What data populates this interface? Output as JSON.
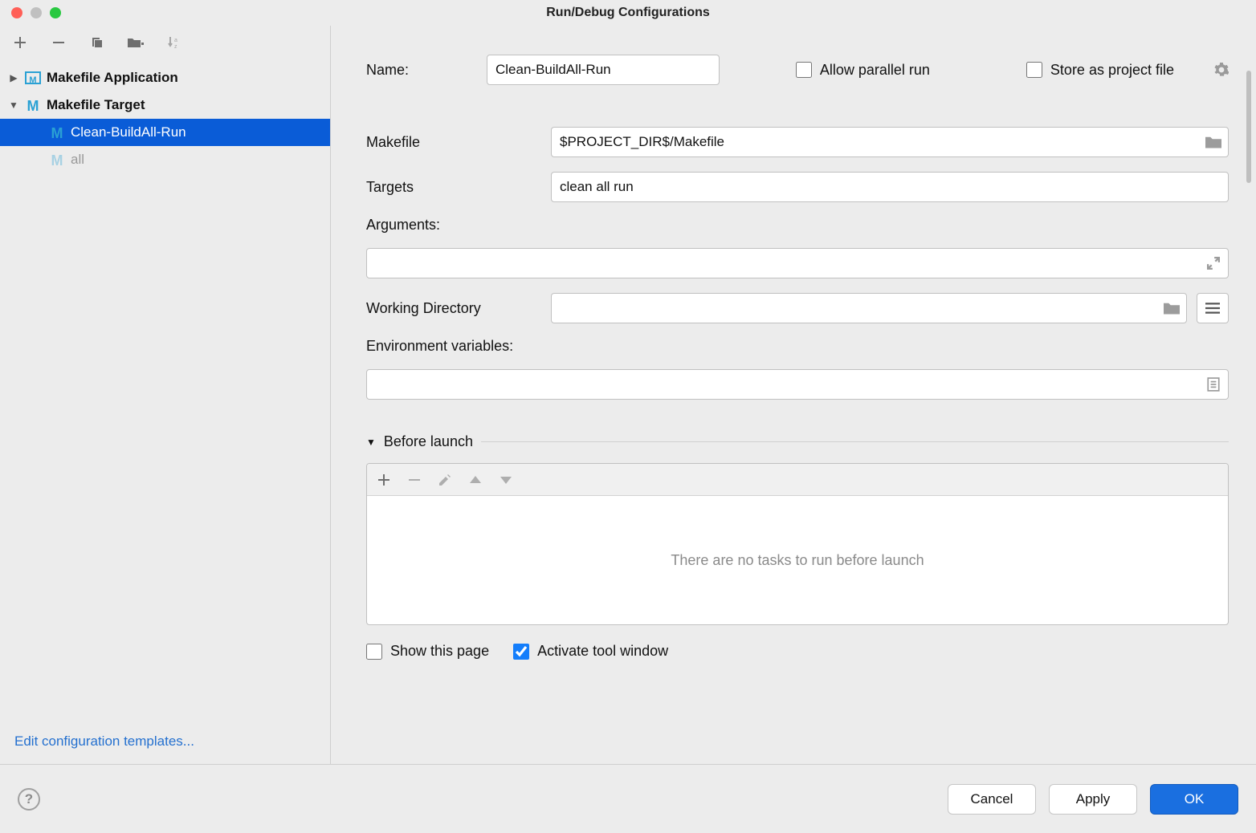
{
  "window": {
    "title": "Run/Debug Configurations"
  },
  "sidebar": {
    "items": [
      {
        "label": "Makefile Application",
        "expandState": "collapsed",
        "type": "app"
      },
      {
        "label": "Makefile Target",
        "expandState": "expanded",
        "type": "target"
      },
      {
        "label": "Clean-BuildAll-Run",
        "type": "target",
        "selected": true
      },
      {
        "label": "all",
        "type": "target",
        "dim": true
      }
    ],
    "editLink": "Edit configuration templates..."
  },
  "details": {
    "nameLabel": "Name:",
    "nameValue": "Clean-BuildAll-Run",
    "allowParallelLabel": "Allow parallel run",
    "allowParallelChecked": false,
    "storeAsProjectLabel": "Store as project file",
    "storeAsProjectChecked": false,
    "makefileLabel": "Makefile",
    "makefileValue": "$PROJECT_DIR$/Makefile",
    "targetsLabel": "Targets",
    "targetsValue": "clean all run",
    "argumentsLabel": "Arguments:",
    "argumentsValue": "",
    "workingDirLabel": "Working Directory",
    "workingDirValue": "",
    "envLabel": "Environment variables:",
    "envValue": "",
    "beforeLaunchLabel": "Before launch",
    "noTasksMessage": "There are no tasks to run before launch",
    "showThisPageLabel": "Show this page",
    "showThisPageChecked": false,
    "activateToolLabel": "Activate tool window",
    "activateToolChecked": true
  },
  "footer": {
    "cancel": "Cancel",
    "apply": "Apply",
    "ok": "OK"
  }
}
